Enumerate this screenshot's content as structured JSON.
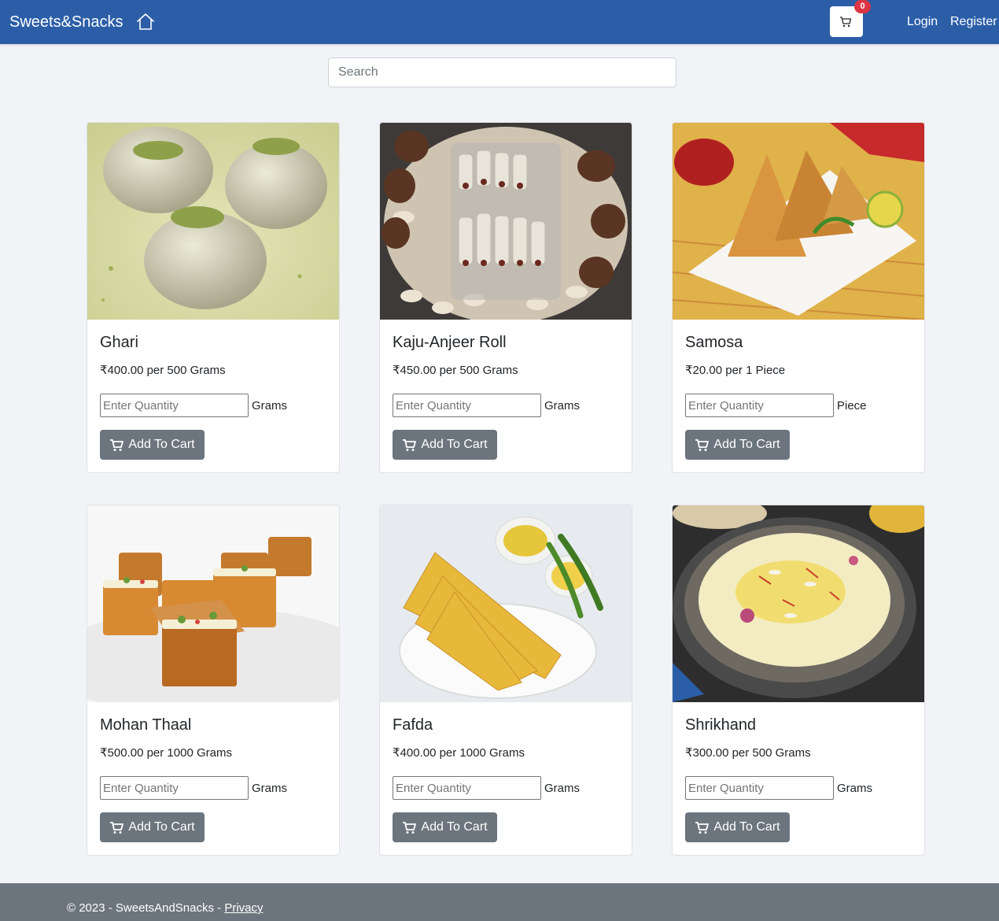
{
  "brand": "Sweets&Snacks",
  "nav": {
    "home_icon": "home-icon",
    "cart_icon": "cart-icon",
    "cart_count": "0",
    "login": "Login",
    "register": "Register"
  },
  "search": {
    "placeholder": "Search",
    "value": ""
  },
  "products": [
    {
      "name": "Ghari",
      "price": "₹400.00 per 500 Grams",
      "qty_placeholder": "Enter Quantity",
      "unit": "Grams",
      "add_label": "Add To Cart"
    },
    {
      "name": "Kaju-Anjeer Roll",
      "price": "₹450.00 per 500 Grams",
      "qty_placeholder": "Enter Quantity",
      "unit": "Grams",
      "add_label": "Add To Cart"
    },
    {
      "name": "Samosa",
      "price": "₹20.00 per 1 Piece",
      "qty_placeholder": "Enter Quantity",
      "unit": "Piece",
      "add_label": "Add To Cart"
    },
    {
      "name": "Mohan Thaal",
      "price": "₹500.00 per 1000 Grams",
      "qty_placeholder": "Enter Quantity",
      "unit": "Grams",
      "add_label": "Add To Cart"
    },
    {
      "name": "Fafda",
      "price": "₹400.00 per 1000 Grams",
      "qty_placeholder": "Enter Quantity",
      "unit": "Grams",
      "add_label": "Add To Cart"
    },
    {
      "name": "Shrikhand",
      "price": "₹300.00 per 500 Grams",
      "qty_placeholder": "Enter Quantity",
      "unit": "Grams",
      "add_label": "Add To Cart"
    }
  ],
  "footer": {
    "text": "© 2023 - SweetsAndSnacks - ",
    "privacy": "Privacy"
  },
  "colors": {
    "navbar": "#2c5ea8",
    "button": "#6c757d",
    "badge": "#dc3545",
    "footer": "#6c757d"
  }
}
